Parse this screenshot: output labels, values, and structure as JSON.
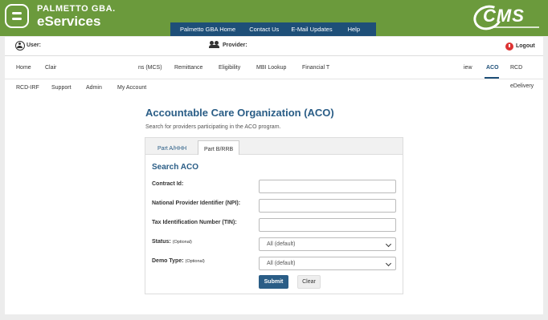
{
  "brand": {
    "top": "PALMETTO GBA.",
    "sub": "eServices",
    "cms": "CMS"
  },
  "topnav": [
    "Palmetto GBA Home",
    "Contact Us",
    "E-Mail Updates",
    "Help"
  ],
  "userbar": {
    "user": "User:",
    "provider": "Provider:",
    "logout": "Logout"
  },
  "nav_row1": [
    "Home",
    "Clair",
    "ns (MCS)",
    "Remittance",
    "Eligibility",
    "MBI Lookup",
    "Financial T",
    "iew",
    "ACO",
    "RCD"
  ],
  "nav_row2": [
    "RCD-IRF",
    "Support",
    "Admin",
    "My Account",
    "eDelivery"
  ],
  "page": {
    "title": "Accountable Care Organization (ACO)",
    "desc": "Search for providers participating in the ACO program."
  },
  "tabs": [
    "Part A/HHH",
    "Part B/RRB"
  ],
  "form": {
    "heading": "Search ACO",
    "contract_label": "Contract Id:",
    "npi_label": "National Provider Identifier (NPI):",
    "tin_label": "Tax Identification Number (TIN):",
    "status_label": "Status:",
    "status_opt": "(Optional)",
    "status_value": "All (default)",
    "demo_label": "Demo Type:",
    "demo_opt": "(Optional)",
    "demo_value": "All (default)",
    "submit": "Submit",
    "clear": "Clear"
  },
  "colors": {
    "header_green": "#6b9a3c",
    "nav_blue": "#1e4f78",
    "title_blue": "#2a5d86",
    "logout_red": "#dd3333"
  }
}
